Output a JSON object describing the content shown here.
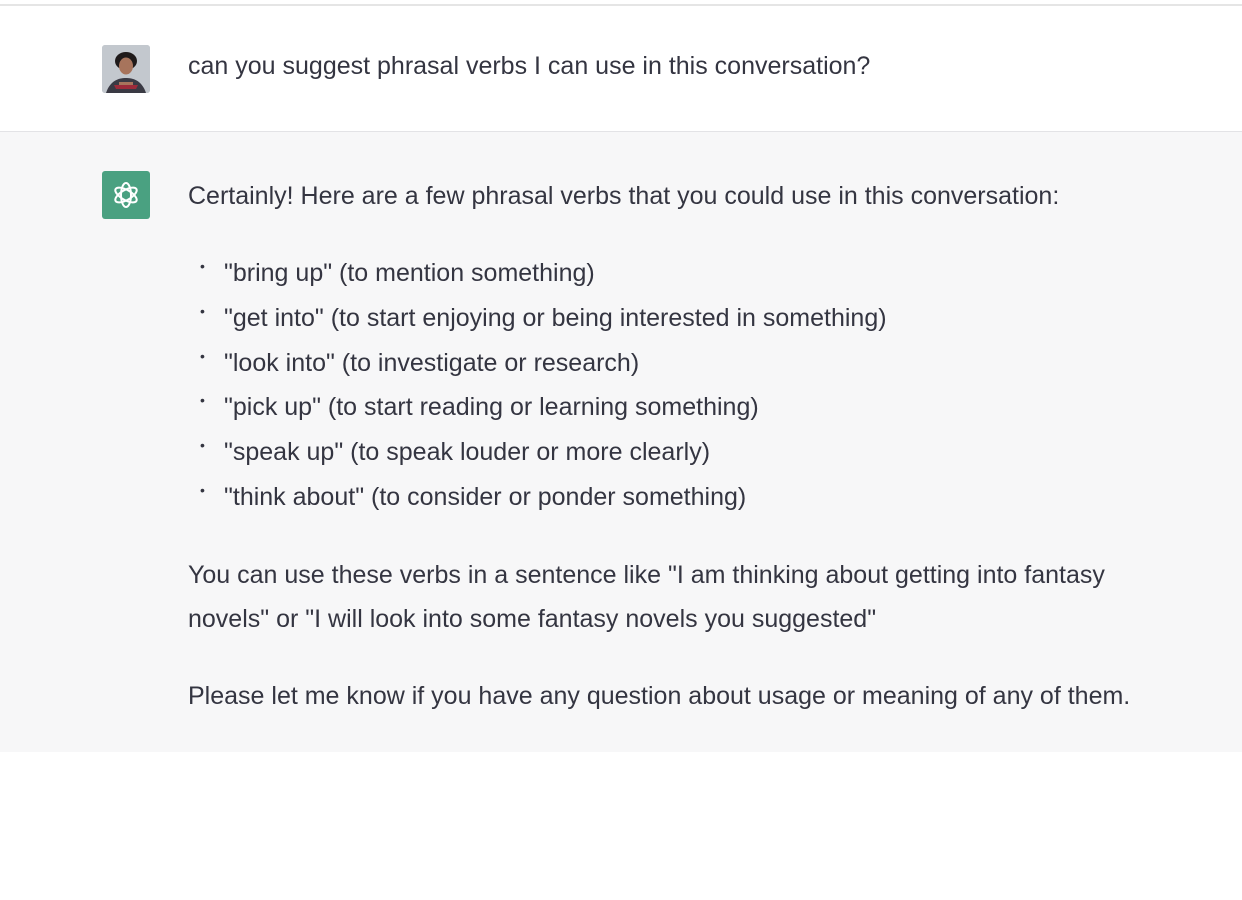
{
  "conversation": {
    "user_message": {
      "avatar_icon": "user-photo-avatar",
      "text": "can you suggest phrasal verbs I can use in this conversation?"
    },
    "assistant_message": {
      "avatar_icon": "openai-logo-icon",
      "avatar_color": "#4aa181",
      "intro": "Certainly! Here are a few phrasal verbs that you could use in this conversation:",
      "items": [
        "\"bring up\" (to mention something)",
        "\"get into\" (to start enjoying or being interested in something)",
        "\"look into\" (to investigate or research)",
        "\"pick up\" (to start reading or learning something)",
        "\"speak up\" (to speak louder or more clearly)",
        "\"think about\" (to consider or ponder something)"
      ],
      "example": "You can use these verbs in a sentence like \"I am thinking about getting into fantasy novels\" or \"I will look into some fantasy novels you suggested\"",
      "closing": "Please let me know if you have any question about usage or meaning of any of them."
    }
  },
  "colors": {
    "text": "#343541",
    "assistant_background": "#f7f7f8",
    "user_background": "#ffffff"
  }
}
